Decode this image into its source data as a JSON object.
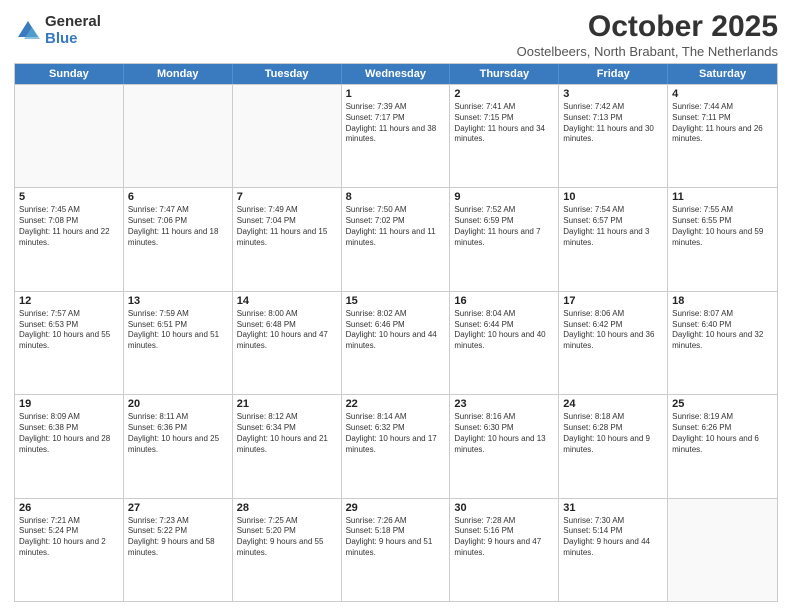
{
  "logo": {
    "general": "General",
    "blue": "Blue"
  },
  "title": "October 2025",
  "subtitle": "Oostelbeers, North Brabant, The Netherlands",
  "calendar": {
    "headers": [
      "Sunday",
      "Monday",
      "Tuesday",
      "Wednesday",
      "Thursday",
      "Friday",
      "Saturday"
    ],
    "weeks": [
      [
        {
          "day": "",
          "sunrise": "",
          "sunset": "",
          "daylight": ""
        },
        {
          "day": "",
          "sunrise": "",
          "sunset": "",
          "daylight": ""
        },
        {
          "day": "",
          "sunrise": "",
          "sunset": "",
          "daylight": ""
        },
        {
          "day": "1",
          "sunrise": "Sunrise: 7:39 AM",
          "sunset": "Sunset: 7:17 PM",
          "daylight": "Daylight: 11 hours and 38 minutes."
        },
        {
          "day": "2",
          "sunrise": "Sunrise: 7:41 AM",
          "sunset": "Sunset: 7:15 PM",
          "daylight": "Daylight: 11 hours and 34 minutes."
        },
        {
          "day": "3",
          "sunrise": "Sunrise: 7:42 AM",
          "sunset": "Sunset: 7:13 PM",
          "daylight": "Daylight: 11 hours and 30 minutes."
        },
        {
          "day": "4",
          "sunrise": "Sunrise: 7:44 AM",
          "sunset": "Sunset: 7:11 PM",
          "daylight": "Daylight: 11 hours and 26 minutes."
        }
      ],
      [
        {
          "day": "5",
          "sunrise": "Sunrise: 7:45 AM",
          "sunset": "Sunset: 7:08 PM",
          "daylight": "Daylight: 11 hours and 22 minutes."
        },
        {
          "day": "6",
          "sunrise": "Sunrise: 7:47 AM",
          "sunset": "Sunset: 7:06 PM",
          "daylight": "Daylight: 11 hours and 18 minutes."
        },
        {
          "day": "7",
          "sunrise": "Sunrise: 7:49 AM",
          "sunset": "Sunset: 7:04 PM",
          "daylight": "Daylight: 11 hours and 15 minutes."
        },
        {
          "day": "8",
          "sunrise": "Sunrise: 7:50 AM",
          "sunset": "Sunset: 7:02 PM",
          "daylight": "Daylight: 11 hours and 11 minutes."
        },
        {
          "day": "9",
          "sunrise": "Sunrise: 7:52 AM",
          "sunset": "Sunset: 6:59 PM",
          "daylight": "Daylight: 11 hours and 7 minutes."
        },
        {
          "day": "10",
          "sunrise": "Sunrise: 7:54 AM",
          "sunset": "Sunset: 6:57 PM",
          "daylight": "Daylight: 11 hours and 3 minutes."
        },
        {
          "day": "11",
          "sunrise": "Sunrise: 7:55 AM",
          "sunset": "Sunset: 6:55 PM",
          "daylight": "Daylight: 10 hours and 59 minutes."
        }
      ],
      [
        {
          "day": "12",
          "sunrise": "Sunrise: 7:57 AM",
          "sunset": "Sunset: 6:53 PM",
          "daylight": "Daylight: 10 hours and 55 minutes."
        },
        {
          "day": "13",
          "sunrise": "Sunrise: 7:59 AM",
          "sunset": "Sunset: 6:51 PM",
          "daylight": "Daylight: 10 hours and 51 minutes."
        },
        {
          "day": "14",
          "sunrise": "Sunrise: 8:00 AM",
          "sunset": "Sunset: 6:48 PM",
          "daylight": "Daylight: 10 hours and 47 minutes."
        },
        {
          "day": "15",
          "sunrise": "Sunrise: 8:02 AM",
          "sunset": "Sunset: 6:46 PM",
          "daylight": "Daylight: 10 hours and 44 minutes."
        },
        {
          "day": "16",
          "sunrise": "Sunrise: 8:04 AM",
          "sunset": "Sunset: 6:44 PM",
          "daylight": "Daylight: 10 hours and 40 minutes."
        },
        {
          "day": "17",
          "sunrise": "Sunrise: 8:06 AM",
          "sunset": "Sunset: 6:42 PM",
          "daylight": "Daylight: 10 hours and 36 minutes."
        },
        {
          "day": "18",
          "sunrise": "Sunrise: 8:07 AM",
          "sunset": "Sunset: 6:40 PM",
          "daylight": "Daylight: 10 hours and 32 minutes."
        }
      ],
      [
        {
          "day": "19",
          "sunrise": "Sunrise: 8:09 AM",
          "sunset": "Sunset: 6:38 PM",
          "daylight": "Daylight: 10 hours and 28 minutes."
        },
        {
          "day": "20",
          "sunrise": "Sunrise: 8:11 AM",
          "sunset": "Sunset: 6:36 PM",
          "daylight": "Daylight: 10 hours and 25 minutes."
        },
        {
          "day": "21",
          "sunrise": "Sunrise: 8:12 AM",
          "sunset": "Sunset: 6:34 PM",
          "daylight": "Daylight: 10 hours and 21 minutes."
        },
        {
          "day": "22",
          "sunrise": "Sunrise: 8:14 AM",
          "sunset": "Sunset: 6:32 PM",
          "daylight": "Daylight: 10 hours and 17 minutes."
        },
        {
          "day": "23",
          "sunrise": "Sunrise: 8:16 AM",
          "sunset": "Sunset: 6:30 PM",
          "daylight": "Daylight: 10 hours and 13 minutes."
        },
        {
          "day": "24",
          "sunrise": "Sunrise: 8:18 AM",
          "sunset": "Sunset: 6:28 PM",
          "daylight": "Daylight: 10 hours and 9 minutes."
        },
        {
          "day": "25",
          "sunrise": "Sunrise: 8:19 AM",
          "sunset": "Sunset: 6:26 PM",
          "daylight": "Daylight: 10 hours and 6 minutes."
        }
      ],
      [
        {
          "day": "26",
          "sunrise": "Sunrise: 7:21 AM",
          "sunset": "Sunset: 5:24 PM",
          "daylight": "Daylight: 10 hours and 2 minutes."
        },
        {
          "day": "27",
          "sunrise": "Sunrise: 7:23 AM",
          "sunset": "Sunset: 5:22 PM",
          "daylight": "Daylight: 9 hours and 58 minutes."
        },
        {
          "day": "28",
          "sunrise": "Sunrise: 7:25 AM",
          "sunset": "Sunset: 5:20 PM",
          "daylight": "Daylight: 9 hours and 55 minutes."
        },
        {
          "day": "29",
          "sunrise": "Sunrise: 7:26 AM",
          "sunset": "Sunset: 5:18 PM",
          "daylight": "Daylight: 9 hours and 51 minutes."
        },
        {
          "day": "30",
          "sunrise": "Sunrise: 7:28 AM",
          "sunset": "Sunset: 5:16 PM",
          "daylight": "Daylight: 9 hours and 47 minutes."
        },
        {
          "day": "31",
          "sunrise": "Sunrise: 7:30 AM",
          "sunset": "Sunset: 5:14 PM",
          "daylight": "Daylight: 9 hours and 44 minutes."
        },
        {
          "day": "",
          "sunrise": "",
          "sunset": "",
          "daylight": ""
        }
      ]
    ]
  }
}
